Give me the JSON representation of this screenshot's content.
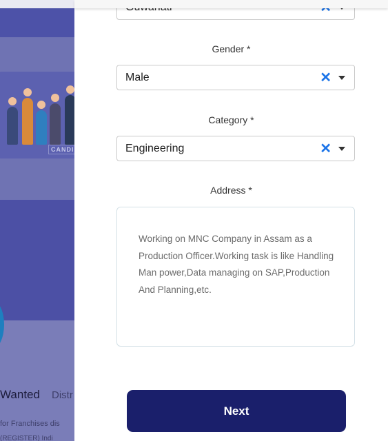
{
  "background": {
    "card_tag": "CANDID",
    "wanted_text": "Wanted",
    "district_text": "Distr",
    "franchise_text": "for Franchises dis",
    "register_text": "(REGISTER) Indi"
  },
  "form": {
    "city": {
      "value": "Guwahati"
    },
    "gender": {
      "label": "Gender *",
      "value": "Male"
    },
    "category": {
      "label": "Category *",
      "value": "Engineering"
    },
    "address": {
      "label": "Address *",
      "value": "Working on MNC Company in Assam as a Production Officer.Working task is like Handling Man power,Data managing on SAP,Production And Planning,etc."
    },
    "next_label": "Next"
  },
  "icons": {
    "clear": "close-x-icon",
    "dropdown": "caret-down-icon"
  },
  "colors": {
    "accent": "#1a73e8",
    "button": "#1a1f6b",
    "overlay": "#6f73b3"
  }
}
